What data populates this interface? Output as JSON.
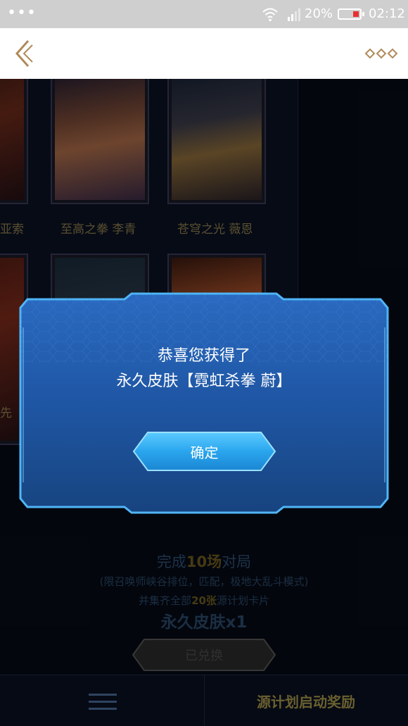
{
  "status_bar": {
    "dots": "•••",
    "battery_percent": "20%",
    "time": "02:12"
  },
  "navbar": {
    "back_icon": "chevron-left-icon",
    "more_icon": "more-dots-icon"
  },
  "skins": [
    {
      "label": "亚索"
    },
    {
      "label": "至高之拳 李青"
    },
    {
      "label": "苍穹之光 薇恩"
    },
    {
      "label": "先"
    }
  ],
  "task": {
    "complete_prefix": "完成",
    "complete_count": "10场",
    "complete_suffix": "对局",
    "limit_text": "(限召唤师峡谷排位，匹配，极地大乱斗模式)",
    "collect_prefix": "并集齐全部",
    "collect_count": "20张",
    "collect_suffix": "源计划卡片",
    "reward_text": "永久皮肤x1",
    "redeemed_label": "已兑换"
  },
  "bottom_bar": {
    "menu_icon": "hamburger-menu-icon",
    "label": "源计划启动奖励"
  },
  "dialog": {
    "line1": "恭喜您获得了",
    "line2": "永久皮肤【霓虹杀拳 蔚】",
    "confirm_label": "确定"
  },
  "colors": {
    "dialog_blue": "#1f5aa8",
    "dialog_border": "#49b4f5",
    "button_cyan": "#33b5f5",
    "gold_text": "#8a7a4a",
    "nav_accent": "#b08a5a"
  }
}
